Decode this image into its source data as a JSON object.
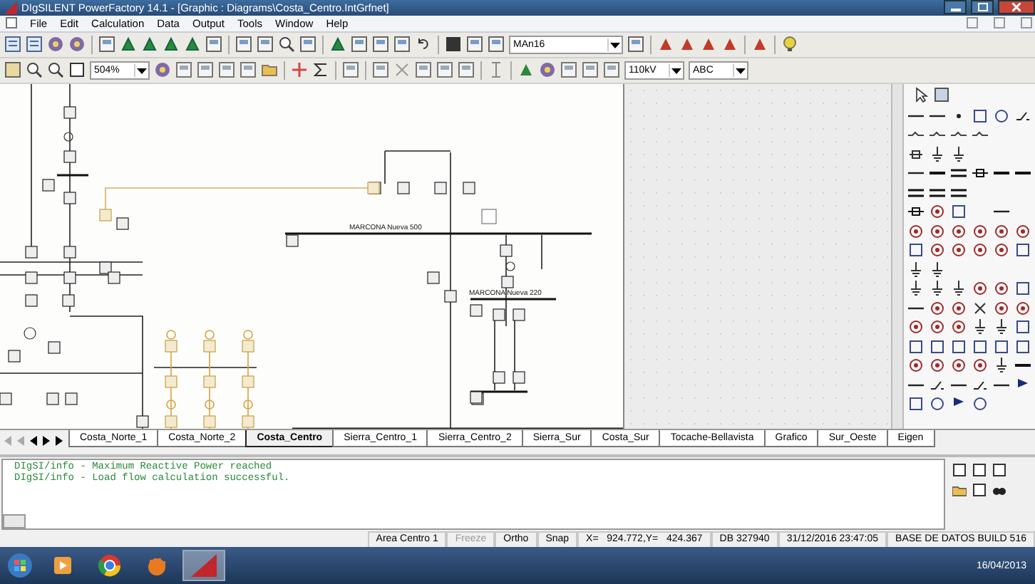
{
  "window": {
    "title": "DIgSILENT PowerFactory 14.1 - [Graphic : Diagrams\\Costa_Centro.IntGrfnet]"
  },
  "menu": [
    "File",
    "Edit",
    "Calculation",
    "Data",
    "Output",
    "Tools",
    "Window",
    "Help"
  ],
  "toolbar": {
    "study_case": "MAn16",
    "zoom": "504%",
    "voltage": "110kV",
    "label_filter": "ABC"
  },
  "diagram": {
    "bus_labels": [
      "MARCONA Nueva 500",
      "MARCONA Nueva 220"
    ]
  },
  "sheet_tabs": [
    {
      "label": "Costa_Norte_1",
      "selected": false
    },
    {
      "label": "Costa_Norte_2",
      "selected": false
    },
    {
      "label": "Costa_Centro",
      "selected": true
    },
    {
      "label": "Sierra_Centro_1",
      "selected": false
    },
    {
      "label": "Sierra_Centro_2",
      "selected": false
    },
    {
      "label": "Sierra_Sur",
      "selected": false
    },
    {
      "label": "Costa_Sur",
      "selected": false
    },
    {
      "label": "Tocache-Bellavista",
      "selected": false
    },
    {
      "label": "Grafico",
      "selected": false
    },
    {
      "label": "Sur_Oeste",
      "selected": false
    },
    {
      "label": "Eigen",
      "selected": false
    }
  ],
  "output": {
    "lines": [
      "DIgSI/info - Maximum Reactive Power reached",
      "DIgSI/info - Load flow calculation successful."
    ]
  },
  "status_bar": [
    {
      "text": "Area Centro 1",
      "disabled": false
    },
    {
      "text": "Freeze",
      "disabled": true
    },
    {
      "text": "Ortho",
      "disabled": false
    },
    {
      "text": "Snap",
      "disabled": false
    },
    {
      "text": "X=   924.772,Y=   424.367",
      "disabled": false
    },
    {
      "text": "DB 327940",
      "disabled": false
    },
    {
      "text": "31/12/2016 23:47:05",
      "disabled": false
    },
    {
      "text": "BASE DE DATOS BUILD 516",
      "disabled": false
    }
  ],
  "taskbar": {
    "apps": [
      {
        "kind": "media",
        "selected": false
      },
      {
        "kind": "browser",
        "selected": false
      },
      {
        "kind": "hand",
        "selected": false
      },
      {
        "kind": "powerfactory",
        "selected": true
      }
    ],
    "date": "16/04/2013"
  }
}
